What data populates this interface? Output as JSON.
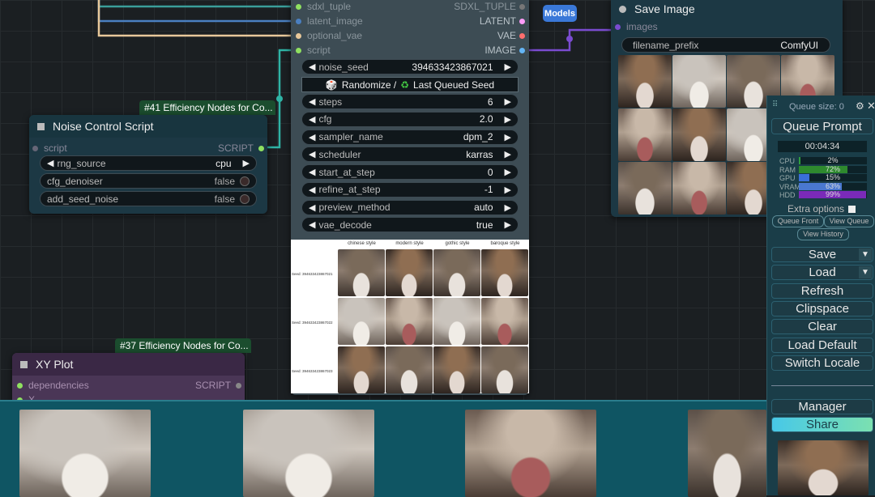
{
  "canvas": {
    "models_button": "Models"
  },
  "noise_node": {
    "badge": "#41 Efficiency Nodes for Co...",
    "title": "Noise Control Script",
    "input_label": "script",
    "output_label": "SCRIPT",
    "widgets": [
      {
        "label": "rng_source",
        "value": "cpu"
      },
      {
        "label": "cfg_denoiser",
        "value": "false"
      },
      {
        "label": "add_seed_noise",
        "value": "false"
      }
    ]
  },
  "ksampler_node": {
    "inputs": [
      {
        "left": "sdxl_tuple",
        "right": "SDXL_TUPLE",
        "color": "#888888"
      },
      {
        "left": "latent_image",
        "right": "LATENT",
        "color": "#ff9cf9"
      },
      {
        "left": "optional_vae",
        "right": "VAE",
        "color": "#ff6e6e"
      },
      {
        "left": "script",
        "right": "IMAGE",
        "color": "#64b5f6"
      }
    ],
    "noise_seed": {
      "label": "noise_seed",
      "value": "394633423867021"
    },
    "randomize": {
      "text": "Randomize / ",
      "text2": "Last Queued Seed"
    },
    "widgets": [
      {
        "label": "steps",
        "value": "6"
      },
      {
        "label": "cfg",
        "value": "2.0"
      },
      {
        "label": "sampler_name",
        "value": "dpm_2"
      },
      {
        "label": "scheduler",
        "value": "karras"
      },
      {
        "label": "start_at_step",
        "value": "0"
      },
      {
        "label": "refine_at_step",
        "value": "-1"
      },
      {
        "label": "preview_method",
        "value": "auto"
      },
      {
        "label": "vae_decode",
        "value": "true"
      }
    ],
    "grid_columns": [
      "chinese style",
      "modern style",
      "gothic style",
      "baroque style"
    ],
    "grid_rows": [
      "Seed: 394633423867021",
      "Seed: 394633423867022",
      "Seed: 394633423867023"
    ]
  },
  "save_node": {
    "title": "Save Image",
    "input_label": "images",
    "filename_label": "filename_prefix",
    "filename_value": "ComfyUI"
  },
  "xy_node": {
    "badge": "#37 Efficiency Nodes for Co...",
    "title": "XY Plot",
    "inputs": [
      "dependencies",
      "X"
    ],
    "output_label": "SCRIPT"
  },
  "queue_panel": {
    "queue_size": "Queue size: 0",
    "queue_prompt": "Queue Prompt",
    "timer": "00:04:34",
    "monitors": [
      {
        "label": "CPU",
        "value": 2,
        "display": "2%",
        "color": "#2e9e3e"
      },
      {
        "label": "RAM",
        "value": 72,
        "display": "72%",
        "color": "#2e8a2e"
      },
      {
        "label": "GPU",
        "value": 15,
        "display": "15%",
        "color": "#3a6fd8"
      },
      {
        "label": "VRAM",
        "value": 63,
        "display": "63%",
        "color": "#4a78d0"
      },
      {
        "label": "HDD",
        "value": 99,
        "display": "99%",
        "color": "#7a2ab8"
      }
    ],
    "extra_options": "Extra options",
    "small_buttons": [
      "Queue Front",
      "View Queue"
    ],
    "view_history": "View History",
    "buttons": [
      "Save",
      "Load",
      "Refresh",
      "Clipspace",
      "Clear",
      "Load Default",
      "Switch Locale"
    ],
    "manager": "Manager",
    "share": "Share"
  },
  "colors": {
    "accent_teal": "#2fb3a5",
    "purple_wire": "#7a4bd0",
    "badge_green": "#1b4d2e",
    "share_gradient": "#4fd0a0"
  }
}
